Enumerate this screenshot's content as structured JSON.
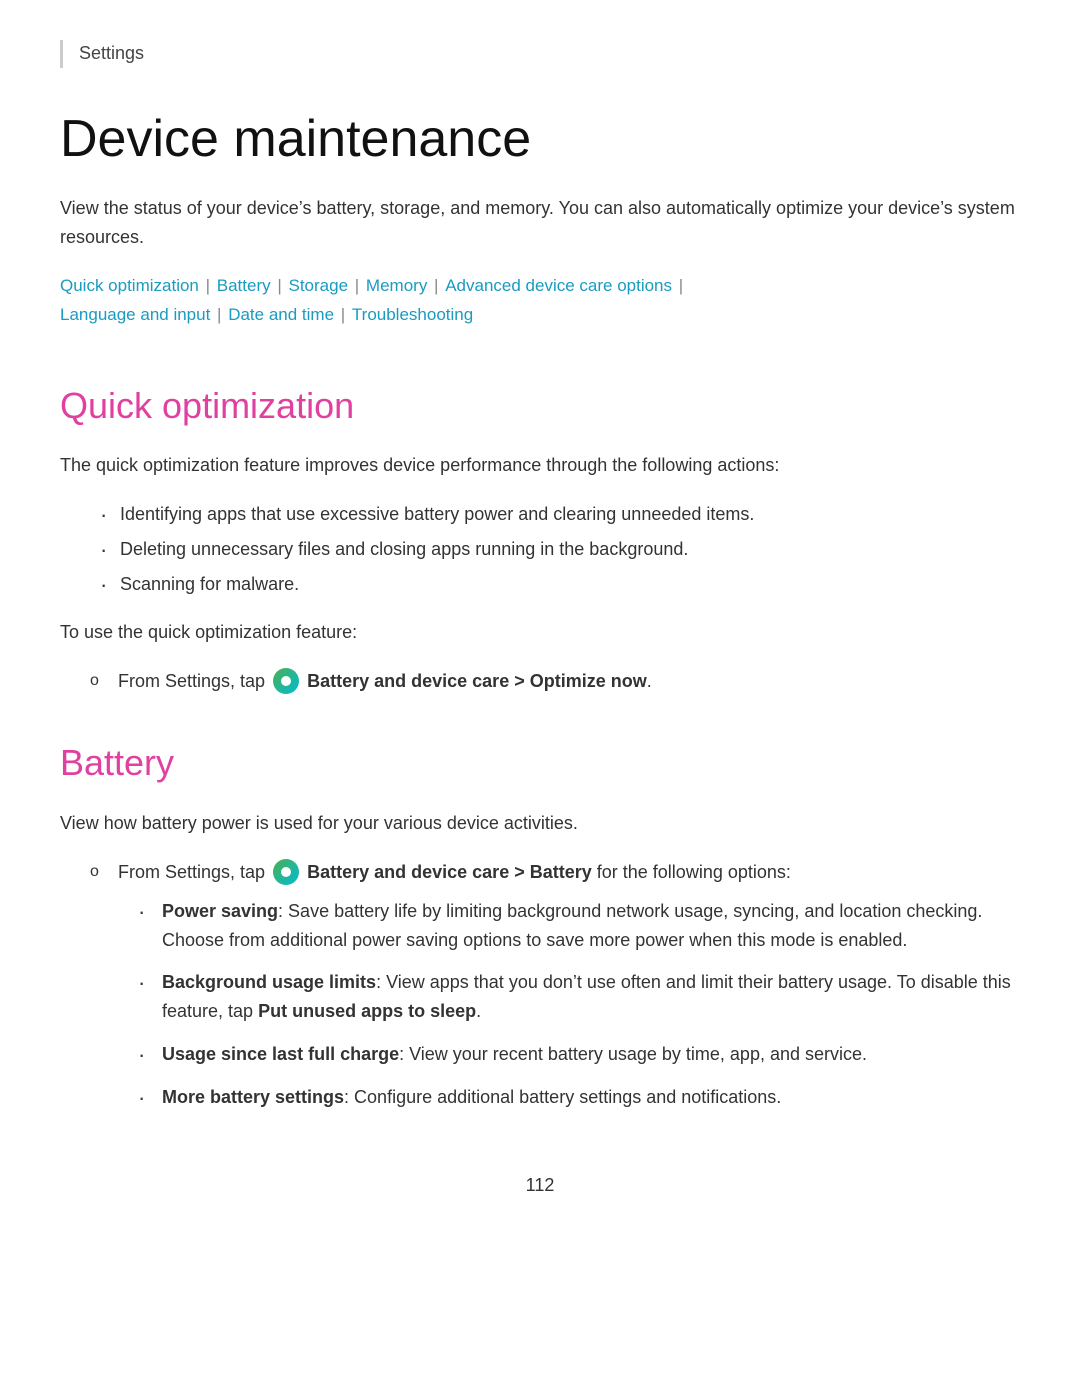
{
  "breadcrumb": "Settings",
  "page": {
    "title": "Device maintenance",
    "description": "View the status of your device’s battery, storage, and memory. You can also automatically optimize your device’s system resources."
  },
  "nav_links": [
    {
      "label": "Quick optimization",
      "href": "#quick-optimization"
    },
    {
      "label": "Battery",
      "href": "#battery"
    },
    {
      "label": "Storage",
      "href": "#storage"
    },
    {
      "label": "Memory",
      "href": "#memory"
    },
    {
      "label": "Advanced device care options",
      "href": "#advanced"
    },
    {
      "label": "Language and input",
      "href": "#language"
    },
    {
      "label": "Date and time",
      "href": "#date-time"
    },
    {
      "label": "Troubleshooting",
      "href": "#troubleshooting"
    }
  ],
  "quick_optimization": {
    "title": "Quick optimization",
    "description": "The quick optimization feature improves device performance through the following actions:",
    "bullets": [
      "Identifying apps that use excessive battery power and clearing unneeded items.",
      "Deleting unnecessary files and closing apps running in the background.",
      "Scanning for malware."
    ],
    "step_intro": "To use the quick optimization feature:",
    "step": "From Settings, tap",
    "step_bold": "Battery and device care > Optimize now",
    "step_suffix": "."
  },
  "battery": {
    "title": "Battery",
    "description": "View how battery power is used for your various device activities.",
    "step_prefix": "From Settings, tap",
    "step_bold": "Battery and device care > Battery",
    "step_suffix": "for the following options:",
    "options": [
      {
        "label": "Power saving",
        "text": ": Save battery life by limiting background network usage, syncing, and location checking. Choose from additional power saving options to save more power when this mode is enabled."
      },
      {
        "label": "Background usage limits",
        "text": ": View apps that you don’t use often and limit their battery usage. To disable this feature, tap",
        "bold_inline": "Put unused apps to sleep",
        "text_after": "."
      },
      {
        "label": "Usage since last full charge",
        "text": ": View your recent battery usage by time, app, and service."
      },
      {
        "label": "More battery settings",
        "text": ": Configure additional battery settings and notifications."
      }
    ]
  },
  "page_number": "112",
  "colors": {
    "link": "#1a9bc0",
    "section_heading": "#e040a0",
    "text": "#333333"
  }
}
